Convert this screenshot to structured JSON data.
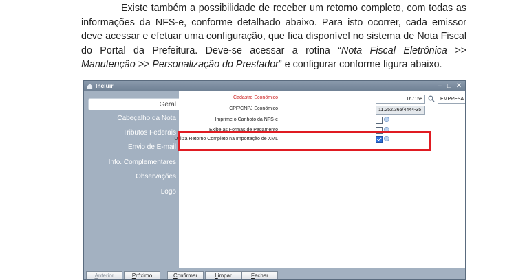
{
  "document": {
    "paragraph_part1": "Existe também a possibilidade de receber um retorno completo, com todas as informações da NFS-e, conforme detalhado abaixo. Para isto ocorrer, cada emissor deve acessar e efetuar uma configuração, que fica disponível no sistema de Nota Fiscal do Portal da Prefeitura. Deve-se acessar a rotina “",
    "paragraph_italic": "Nota Fiscal Eletrônica >> Manutenção >> Personalização do Prestador",
    "paragraph_part2": "” e configurar conforme figura abaixo."
  },
  "window": {
    "title": "Incluir",
    "icon": "home-icon",
    "controls": [
      "minimize-icon",
      "maximize-icon",
      "close-icon"
    ]
  },
  "sidebar": {
    "items": [
      {
        "label": "Geral",
        "active": true
      },
      {
        "label": "Cabeçalho da Nota"
      },
      {
        "label": "Tributos Federais"
      },
      {
        "label": "Envio de E-mail"
      },
      {
        "label": "Info. Complementares"
      },
      {
        "label": "Observações"
      },
      {
        "label": "Logo"
      }
    ]
  },
  "form": {
    "cadastro_label": "Cadastro Econômico",
    "cadastro_value": "167158",
    "empresa_value": "EMPRESA TESTE DE SINCRONIZAÇÃO DATAM",
    "cpf_label": "CPF/CNPJ Econômico",
    "cpf_value": "11.252.365/4444-35",
    "canhoto_label": "Imprime o Canhoto da NFS-e",
    "formas_label": "Exibe as Formas de Pagamento",
    "retorno_label": "Utiliza Retorno Completo na Importação de XML",
    "retorno_checked": true
  },
  "footer": {
    "anterior_first": "A",
    "anterior_rest": "nterior",
    "proximo_first": "P",
    "proximo_rest": "róximo",
    "confirmar_first": "C",
    "confirmar_rest": "onfirmar",
    "limpar_first": "L",
    "limpar_rest": "impar",
    "fechar_first": "F",
    "fechar_rest": "echar"
  },
  "colors": {
    "highlight": "#e01b22",
    "sidebar": "#a3b1c1",
    "titlebar": "#6e7f93",
    "required_label": "#cc1f1f"
  }
}
